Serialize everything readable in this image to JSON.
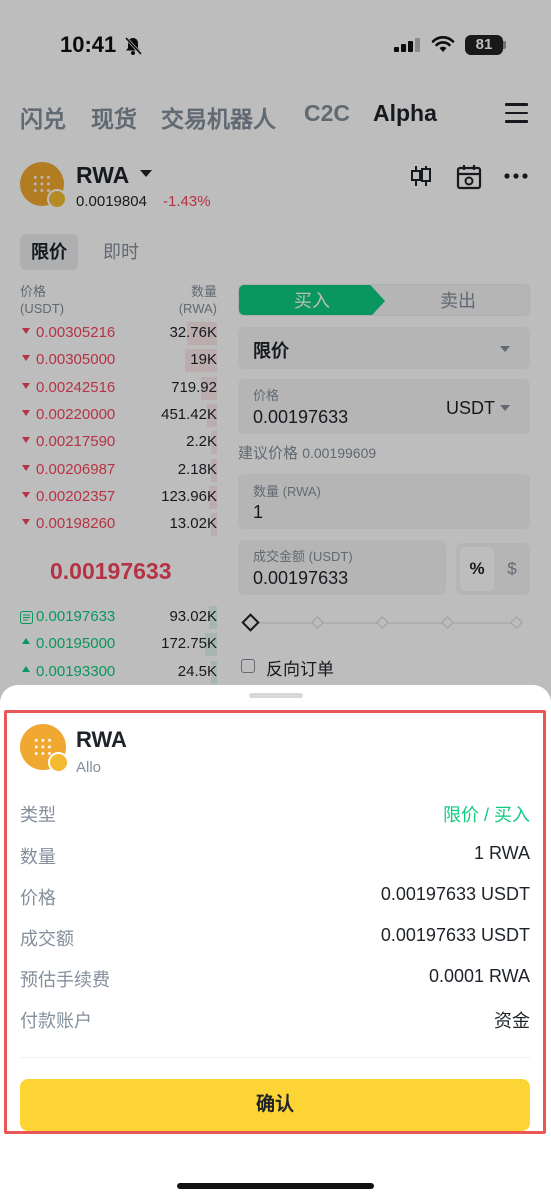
{
  "status_bar": {
    "time": "10:41",
    "battery": "81"
  },
  "top_tabs": [
    "闪兑",
    "现货",
    "交易机器人",
    "C2C",
    "Alpha"
  ],
  "pair": {
    "name": "RWA",
    "price": "0.0019804",
    "change": "-1.43%"
  },
  "order_type_tabs": [
    "限价",
    "即时"
  ],
  "orderbook": {
    "price_header": "价格",
    "price_unit": "(USDT)",
    "qty_header": "数量",
    "qty_unit": "(RWA)",
    "asks": [
      {
        "price": "0.00305216",
        "qty": "32.76K",
        "depth": 0.15
      },
      {
        "price": "0.00305000",
        "qty": "19K",
        "depth": 0.16
      },
      {
        "price": "0.00242516",
        "qty": "719.92",
        "depth": 0.08
      },
      {
        "price": "0.00220000",
        "qty": "451.42K",
        "depth": 0.05
      },
      {
        "price": "0.00217590",
        "qty": "2.2K",
        "depth": 0.03
      },
      {
        "price": "0.00206987",
        "qty": "2.18K",
        "depth": 0.03
      },
      {
        "price": "0.00202357",
        "qty": "123.96K",
        "depth": 0.04
      },
      {
        "price": "0.00198260",
        "qty": "13.02K",
        "depth": 0.03
      }
    ],
    "mid_price": "0.00197633",
    "bids": [
      {
        "price": "0.00197633",
        "qty": "93.02K",
        "depth": 0.04
      },
      {
        "price": "0.00195000",
        "qty": "172.75K",
        "depth": 0.06
      },
      {
        "price": "0.00193300",
        "qty": "24.5K",
        "depth": 0.03
      }
    ]
  },
  "form": {
    "buy_label": "买入",
    "sell_label": "卖出",
    "order_type": "限价",
    "price_label": "价格",
    "price_value": "0.00197633",
    "price_unit": "USDT",
    "suggest_label": "建议价格",
    "suggest_value": "0.00199609",
    "qty_label": "数量 (RWA)",
    "qty_value": "1",
    "total_label": "成交金额 (USDT)",
    "total_value": "0.00197633",
    "pct_label": "%",
    "usd_label": "$",
    "reverse_label": "反向订单"
  },
  "sheet": {
    "token_name": "RWA",
    "token_sub": "Allo",
    "rows": [
      {
        "label": "类型",
        "value": "限价 / 买入"
      },
      {
        "label": "数量",
        "value": "1 RWA"
      },
      {
        "label": "价格",
        "value": "0.00197633 USDT"
      },
      {
        "label": "成交额",
        "value": "0.00197633 USDT"
      },
      {
        "label": "预估手续费",
        "value": "0.0001 RWA"
      },
      {
        "label": "付款账户",
        "value": "资金"
      }
    ],
    "confirm_label": "确认"
  }
}
